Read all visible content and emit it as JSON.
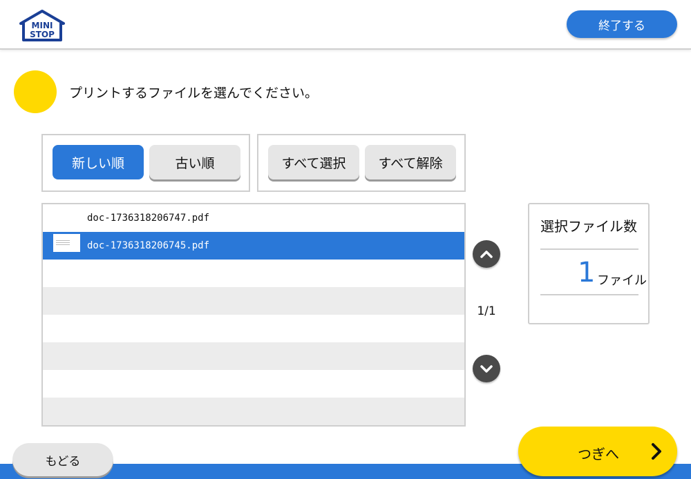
{
  "header": {
    "logo_text_line1": "MINI",
    "logo_text_line2": "STOP",
    "end_label": "終了する"
  },
  "instruction": "プリントするファイルを選んでください。",
  "sort_buttons": {
    "newest": "新しい順",
    "oldest": "古い順"
  },
  "select_buttons": {
    "select_all": "すべて選択",
    "deselect_all": "すべて解除"
  },
  "files": [
    {
      "name": "doc-1736318206747.pdf",
      "selected": false
    },
    {
      "name": "doc-1736318206745.pdf",
      "selected": true
    }
  ],
  "pagination": {
    "indicator": "1/1"
  },
  "selected_count": {
    "title": "選択ファイル数",
    "count": "1",
    "unit": "ファイル"
  },
  "footer": {
    "back_label": "もどる",
    "next_label": "つぎへ"
  },
  "colors": {
    "accent_blue": "#2a78d8",
    "accent_yellow": "#ffd900",
    "button_gray": "#e6e6e6"
  },
  "icons": [
    "ministop-logo",
    "chevron-up-icon",
    "chevron-down-icon",
    "chevron-right-icon"
  ]
}
